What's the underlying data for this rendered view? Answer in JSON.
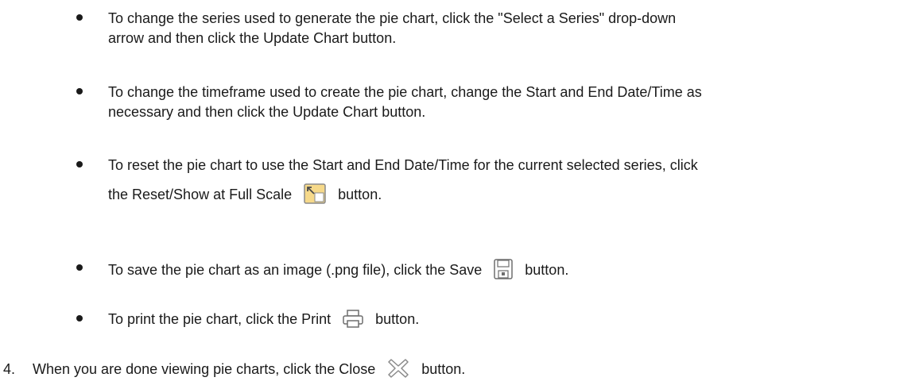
{
  "bullets": [
    {
      "text_line1": "To change the series used to generate the pie chart, click the \"Select a Series\" drop-down",
      "text_line2": "arrow and then click the Update Chart button."
    },
    {
      "text_line1": "To change the timeframe used to create the pie chart, change the Start and End Date/Time as",
      "text_line2": "necessary and then click the Update Chart button."
    },
    {
      "text_line1": "To reset the pie chart to use the Start and End Date/Time for the current selected series, click",
      "text_before_icon": "the Reset/Show at Full Scale",
      "icon": "reset-full-scale-icon",
      "text_after_icon": "button."
    },
    {
      "text_before_icon": "To save the pie chart as an image (.png file), click the Save",
      "icon": "save-icon",
      "text_after_icon": "button."
    },
    {
      "text_before_icon": "To print the pie chart, click the Print",
      "icon": "print-icon",
      "text_after_icon": "button."
    }
  ],
  "step4": {
    "number": "4.",
    "text_before_icon": "When you are done viewing pie charts, click the Close",
    "icon": "close-icon",
    "text_after_icon": "button."
  },
  "colors": {
    "text": "#1a1a1a",
    "reset_icon_fill": "#f6d98a",
    "reset_icon_border": "#8a8a8a",
    "icon_gray": "#6e6e6e"
  }
}
